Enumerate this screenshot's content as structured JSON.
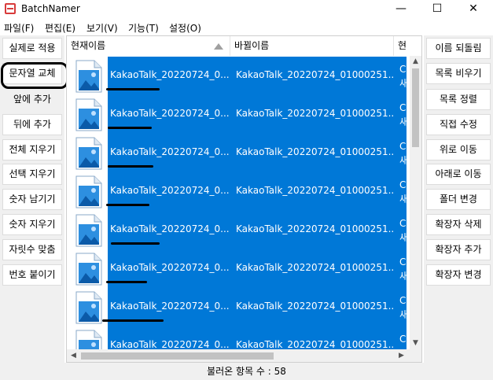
{
  "window": {
    "title": "BatchNamer",
    "minimize": "—",
    "maximize": "☐",
    "close": "✕"
  },
  "menu": [
    "파일(F)",
    "편집(E)",
    "보기(V)",
    "기능(T)",
    "설정(O)"
  ],
  "left_buttons": [
    "실제로 적용",
    "문자열 교체",
    "앞에 추가",
    "뒤에 추가",
    "전체 지우기",
    "선택 지우기",
    "숫자 남기기",
    "숫자 지우기",
    "자릿수 맞춤",
    "번호 붙이기"
  ],
  "right_buttons": [
    "이름 되돌림",
    "목록 비우기",
    "목록 정렬",
    "직접 수정",
    "위로 이동",
    "아래로 이동",
    "폴더 변경",
    "확장자 삭제",
    "확장자 추가",
    "확장자 변경"
  ],
  "columns": {
    "current": "현재이름",
    "new": "바뀔이름",
    "path": "현기"
  },
  "rows": [
    {
      "current": "KakaoTalk_20220724_0...",
      "new": "KakaoTalk_20220724_01000251...",
      "path1": "C:",
      "path2": "새"
    },
    {
      "current": "KakaoTalk_20220724_0...",
      "new": "KakaoTalk_20220724_01000251...",
      "path1": "C:",
      "path2": "새"
    },
    {
      "current": "KakaoTalk_20220724_0...",
      "new": "KakaoTalk_20220724_01000251...",
      "path1": "C:",
      "path2": "새"
    },
    {
      "current": "KakaoTalk_20220724_0...",
      "new": "KakaoTalk_20220724_01000251...",
      "path1": "C:",
      "path2": "새"
    },
    {
      "current": "KakaoTalk_20220724_0...",
      "new": "KakaoTalk_20220724_01000251...",
      "path1": "C:",
      "path2": "새"
    },
    {
      "current": "KakaoTalk_20220724_0...",
      "new": "KakaoTalk_20220724_01000251...",
      "path1": "C:",
      "path2": "새"
    },
    {
      "current": "KakaoTalk_20220724_0...",
      "new": "KakaoTalk_20220724_01000251...",
      "path1": "C:",
      "path2": "새"
    },
    {
      "current": "KakaoTalk_20220724_0...",
      "new": "KakaoTalk_20220724_01000251...",
      "path1": "C:",
      "path2": ""
    }
  ],
  "status": "불러온 항목 수 : 58",
  "icons": {
    "file": "image-file-icon",
    "sort": "sort-ascending-icon"
  },
  "colors": {
    "selection": "#0078d7",
    "file_icon": "#2d8fe0",
    "app_icon": "#d83b3b"
  }
}
